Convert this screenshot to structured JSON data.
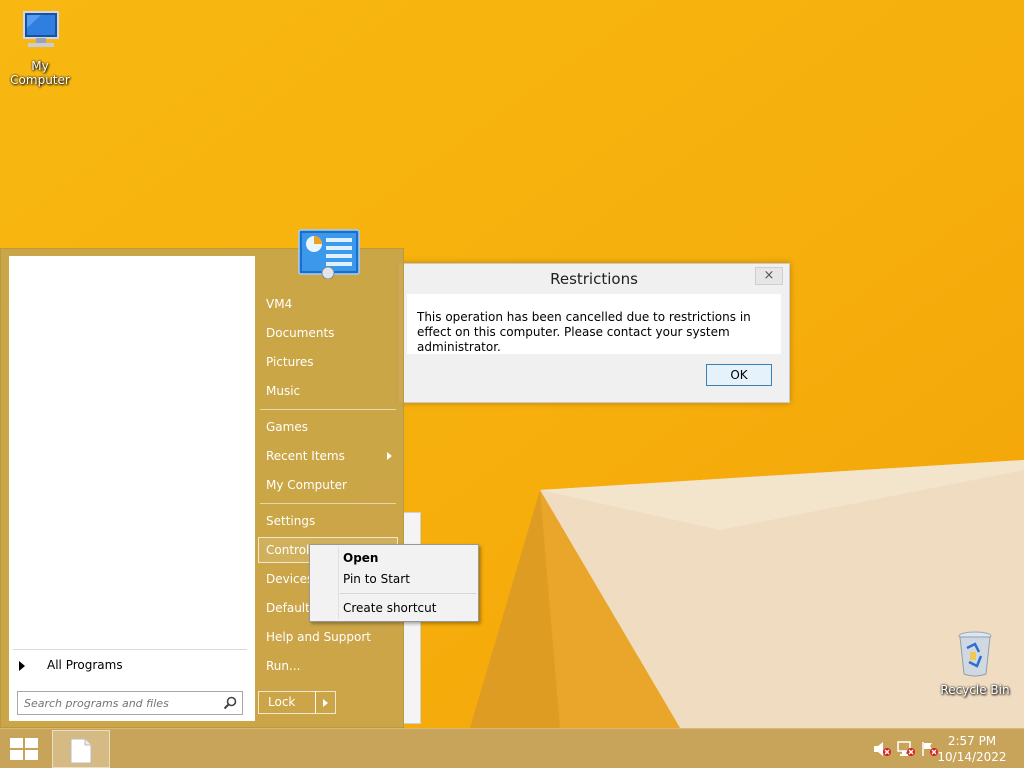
{
  "desktop": {
    "icons": [
      {
        "label": "My Computer"
      },
      {
        "label": "Recycle Bin"
      }
    ]
  },
  "dialog": {
    "title": "Restrictions",
    "close_label": "×",
    "message": "This operation has been cancelled due to restrictions in effect on this computer. Please contact your system administrator.",
    "ok_label": "OK"
  },
  "startmenu": {
    "all_programs_label": "All Programs",
    "search_placeholder": "Search programs and files",
    "right_items": [
      {
        "label": "VM4"
      },
      {
        "label": "Documents"
      },
      {
        "label": "Pictures"
      },
      {
        "label": "Music"
      },
      {
        "label": "Games"
      },
      {
        "label": "Recent Items"
      },
      {
        "label": "My Computer"
      },
      {
        "label": "Settings"
      },
      {
        "label": "Control Panel"
      },
      {
        "label": "Devices and Printers"
      },
      {
        "label": "Default Programs"
      },
      {
        "label": "Help and Support"
      },
      {
        "label": "Run..."
      }
    ],
    "lock_label": "Lock"
  },
  "context_menu": {
    "items": [
      {
        "label": "Open"
      },
      {
        "label": "Pin to Start"
      },
      {
        "label": "Create shortcut"
      }
    ]
  },
  "taskbar": {
    "time": "2:57 PM",
    "date": "10/14/2022"
  },
  "colors": {
    "desktop_orange": "#f6b40f",
    "start_menu_tan": "#c8a54b",
    "accent_blue": "#3c7fb1"
  }
}
